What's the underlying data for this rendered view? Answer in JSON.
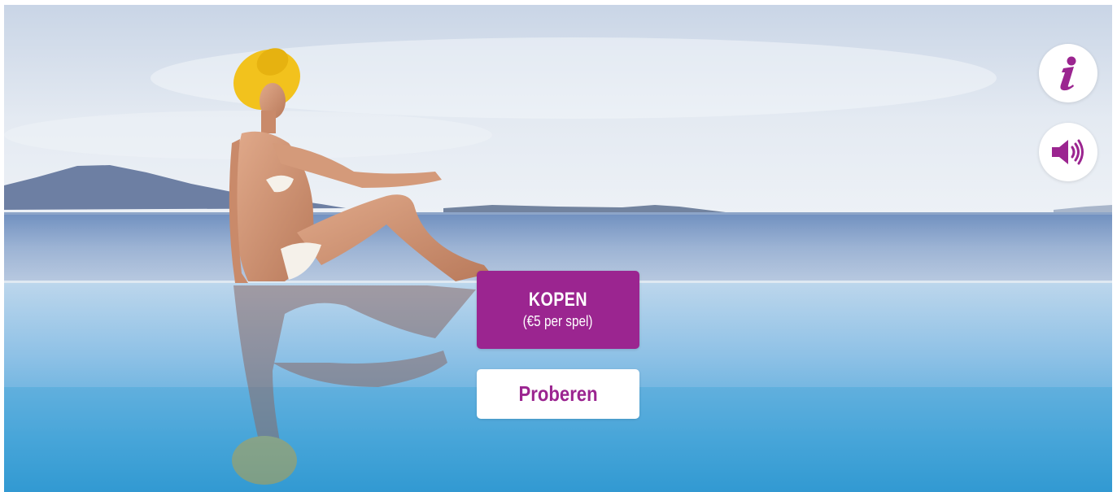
{
  "buy": {
    "title": "KOPEN",
    "subtitle": "(€5 per spel)"
  },
  "try": {
    "label": "Proberen"
  },
  "icons": {
    "info": "info-icon",
    "sound": "speaker-volume-icon"
  },
  "colors": {
    "accent": "#9b2590",
    "button_text_light": "#ffffff",
    "secondary_bg": "#ffffff"
  }
}
